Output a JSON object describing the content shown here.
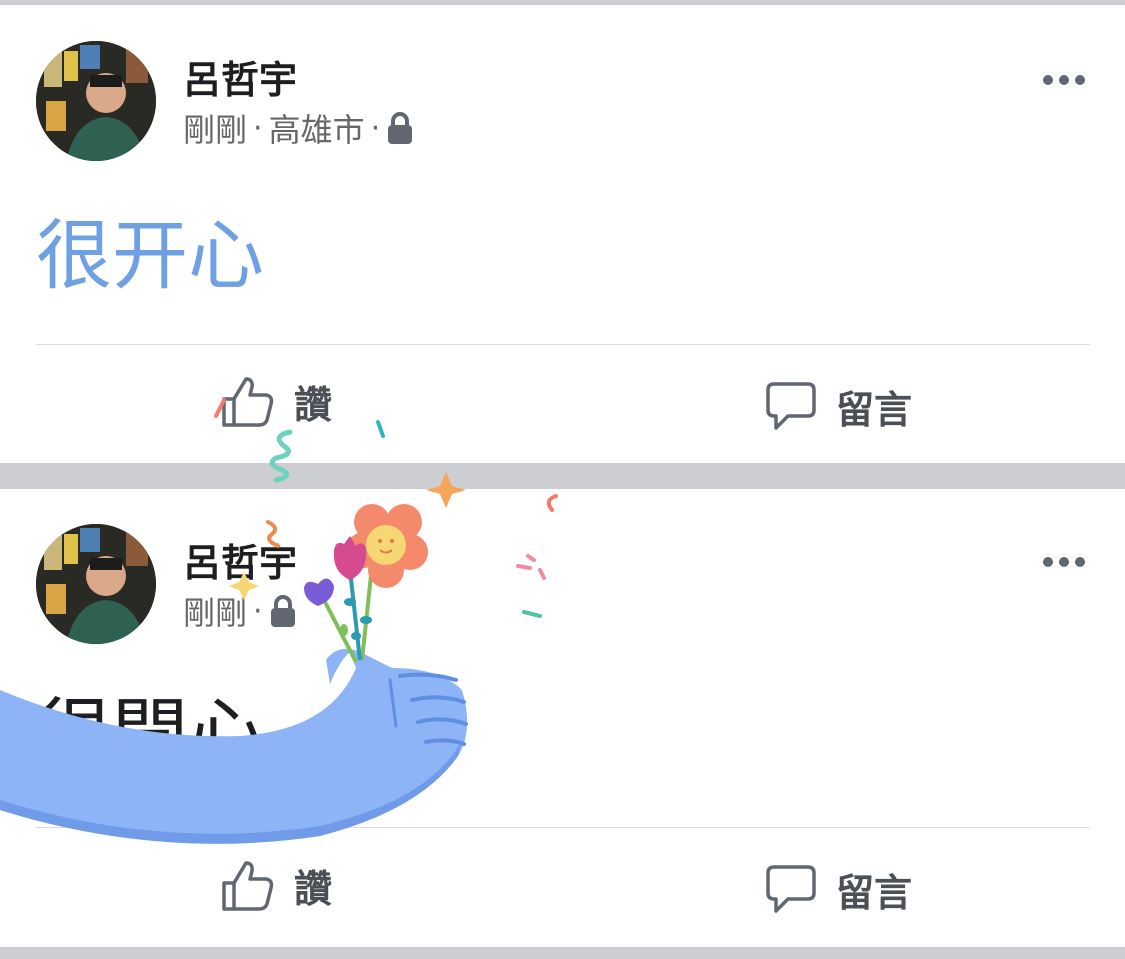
{
  "posts": [
    {
      "author": "呂哲宇",
      "time": "剛剛",
      "location": "高雄市",
      "privacy_icon": "lock-icon",
      "text": "很开心",
      "text_color": "#6fa0e1",
      "actions": {
        "like_label": "讚",
        "comment_label": "留言"
      }
    },
    {
      "author": "呂哲宇",
      "time": "剛剛",
      "privacy_icon": "lock-icon",
      "text": "很開心",
      "text_color": "#1c1e21",
      "actions": {
        "like_label": "讚",
        "comment_label": "留言"
      }
    }
  ],
  "overlay": {
    "type": "celebration-animation",
    "icons": [
      "flower-bouquet-icon",
      "hand-icon",
      "confetti-icon",
      "sparkle-icon"
    ],
    "arm_color": "#8db4f7"
  },
  "colors": {
    "separator": "#cdced2",
    "icon_gray": "#606770",
    "action_text": "#4b4f56"
  }
}
